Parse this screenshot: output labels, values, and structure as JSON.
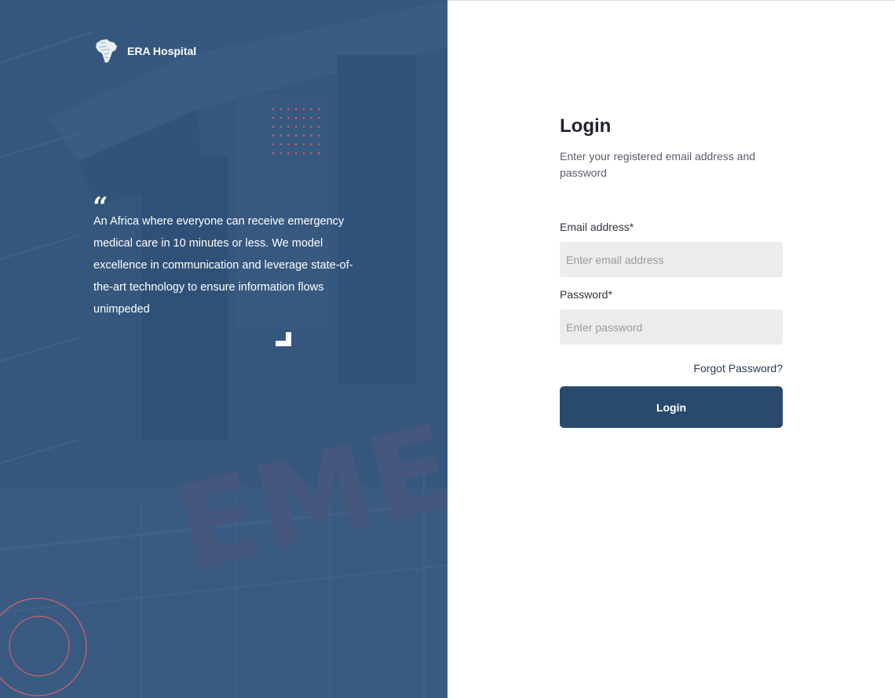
{
  "brand": {
    "name": "ERA Hospital",
    "logo_icon": "africa-map-icon"
  },
  "hero": {
    "quote_icon": "quote-icon",
    "quote": "An Africa where everyone can receive emergency medical care in 10 minutes or less. We model excellence in communication and leverage state-of-the-art technology to ensure information flows unimpeded",
    "background_sign_text": "EMERG"
  },
  "login": {
    "title": "Login",
    "subtitle": "Enter your registered email address and password",
    "email_label": "Email address*",
    "email_placeholder": "Enter email address",
    "email_value": "",
    "password_label": "Password*",
    "password_placeholder": "Enter password",
    "password_value": "",
    "forgot_label": "Forgot Password?",
    "submit_label": "Login"
  },
  "colors": {
    "panel_bg": "#35577e",
    "primary_button": "#294a6d",
    "accent_dots": "#e0606a",
    "input_bg": "#ececec"
  }
}
